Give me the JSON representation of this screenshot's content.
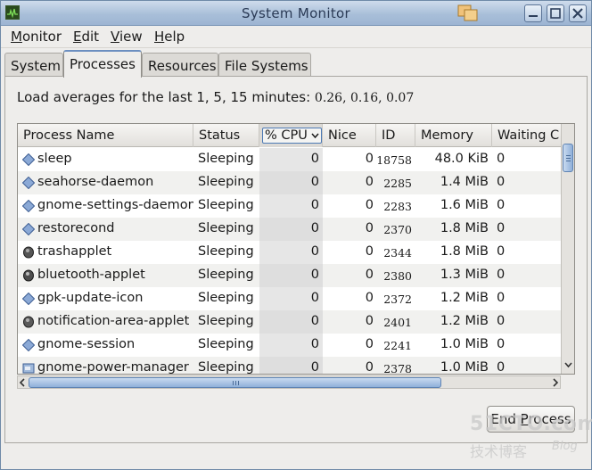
{
  "window": {
    "title": "System Monitor"
  },
  "menu": [
    {
      "label": "Monitor",
      "mnemonic": "M",
      "rest": "onitor"
    },
    {
      "label": "Edit",
      "mnemonic": "E",
      "rest": "dit"
    },
    {
      "label": "View",
      "mnemonic": "V",
      "rest": "iew"
    },
    {
      "label": "Help",
      "mnemonic": "H",
      "rest": "elp"
    }
  ],
  "tabs": [
    {
      "label": "System",
      "active": false
    },
    {
      "label": "Processes",
      "active": true
    },
    {
      "label": "Resources",
      "active": false
    },
    {
      "label": "File Systems",
      "active": false
    }
  ],
  "load_averages": {
    "label": "Load averages for the last 1, 5, 15 minutes:",
    "values": "0.26, 0.16, 0.07"
  },
  "table": {
    "columns": [
      "Process Name",
      "Status",
      "% CPU",
      "Nice",
      "ID",
      "Memory",
      "Waiting C"
    ],
    "sorted_column": "% CPU",
    "rows": [
      {
        "icon": "diamond-icon",
        "name": "sleep",
        "status": "Sleeping",
        "cpu": "0",
        "nice": "0",
        "id": "18758",
        "memory": "48.0 KiB",
        "waiting": "0"
      },
      {
        "icon": "diamond-icon",
        "name": "seahorse-daemon",
        "status": "Sleeping",
        "cpu": "0",
        "nice": "0",
        "id": "2285",
        "memory": "1.4 MiB",
        "waiting": "0"
      },
      {
        "icon": "diamond-icon",
        "name": "gnome-settings-daemon",
        "status": "Sleeping",
        "cpu": "0",
        "nice": "0",
        "id": "2283",
        "memory": "1.6 MiB",
        "waiting": "0"
      },
      {
        "icon": "diamond-icon",
        "name": "restorecond",
        "status": "Sleeping",
        "cpu": "0",
        "nice": "0",
        "id": "2370",
        "memory": "1.8 MiB",
        "waiting": "0"
      },
      {
        "icon": "trash-icon",
        "name": "trashapplet",
        "status": "Sleeping",
        "cpu": "0",
        "nice": "0",
        "id": "2344",
        "memory": "1.8 MiB",
        "waiting": "0"
      },
      {
        "icon": "bluetooth-icon",
        "name": "bluetooth-applet",
        "status": "Sleeping",
        "cpu": "0",
        "nice": "0",
        "id": "2380",
        "memory": "1.3 MiB",
        "waiting": "0"
      },
      {
        "icon": "diamond-icon",
        "name": "gpk-update-icon",
        "status": "Sleeping",
        "cpu": "0",
        "nice": "0",
        "id": "2372",
        "memory": "1.2 MiB",
        "waiting": "0"
      },
      {
        "icon": "applet-icon",
        "name": "notification-area-applet",
        "status": "Sleeping",
        "cpu": "0",
        "nice": "0",
        "id": "2401",
        "memory": "1.2 MiB",
        "waiting": "0"
      },
      {
        "icon": "diamond-icon",
        "name": "gnome-session",
        "status": "Sleeping",
        "cpu": "0",
        "nice": "0",
        "id": "2241",
        "memory": "1.0 MiB",
        "waiting": "0"
      },
      {
        "icon": "power-icon",
        "name": "gnome-power-manager",
        "status": "Sleeping",
        "cpu": "0",
        "nice": "0",
        "id": "2378",
        "memory": "1.0 MiB",
        "waiting": "0"
      }
    ]
  },
  "actions": {
    "end_process": "End Process",
    "end_process_mnemonic": "P"
  },
  "watermark": {
    "main": "51CTO.com",
    "sub": "技术博客",
    "blog": "Blog"
  }
}
